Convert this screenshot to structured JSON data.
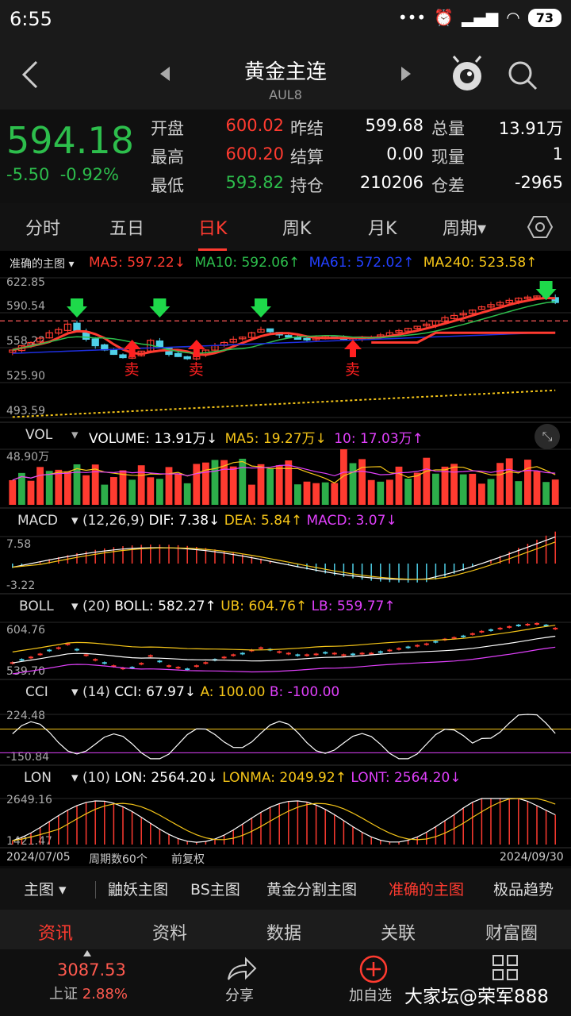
{
  "status": {
    "time": "6:55",
    "battery": "73"
  },
  "header": {
    "title": "黄金主连",
    "code": "AUL8"
  },
  "quote": {
    "price": "594.18",
    "change": "-5.50",
    "change_pct": "-0.92%",
    "rows": [
      {
        "l1": "开盘",
        "v1": "600.02",
        "c1": "#ff3b30",
        "l2": "昨结",
        "v2": "599.68",
        "l3": "总量",
        "v3": "13.91万"
      },
      {
        "l1": "最高",
        "v1": "600.20",
        "c1": "#ff3b30",
        "l2": "结算",
        "v2": "0.00",
        "l3": "现量",
        "v3": "1"
      },
      {
        "l1": "最低",
        "v1": "593.82",
        "c1": "#2dbe4c",
        "l2": "持仓",
        "v2": "210206",
        "l3": "仓差",
        "v3": "-2965"
      }
    ]
  },
  "tabs": [
    "分时",
    "五日",
    "日K",
    "周K",
    "月K",
    "周期▾"
  ],
  "active_tab": "日K",
  "main_chart": {
    "name": "准确的主图",
    "ma5": "MA5: 597.22↓",
    "ma10": "MA10: 592.06↑",
    "ma61": "MA61: 572.02↑",
    "ma240": "MA240: 523.58↑",
    "ticks": [
      "622.85",
      "590.54",
      "558.22",
      "525.90",
      "493.59"
    ],
    "sell": "卖",
    "colors": {
      "ma5": "#ff3b30",
      "ma10": "#2dbe4c",
      "ma61": "#1e2fe0",
      "ma240": "#f5c518"
    }
  },
  "vol": {
    "name": "VOL",
    "v1": "VOLUME: 13.91万↓",
    "v2": "MA5: 19.27万↓",
    "v3": "10: 17.03万↑",
    "tick": "48.90万"
  },
  "macd": {
    "name": "MACD",
    "params": "(12,26,9)",
    "v1": "DIF: 7.38↓",
    "v2": "DEA: 5.84↑",
    "v3": "MACD: 3.07↓",
    "t1": "7.58",
    "t2": "-3.22"
  },
  "boll": {
    "name": "BOLL",
    "params": "(20)",
    "v1": "BOLL: 582.27↑",
    "v2": "UB: 604.76↑",
    "v3": "LB: 559.77↑",
    "t1": "604.76",
    "t2": "539.70"
  },
  "cci": {
    "name": "CCI",
    "params": "(14)",
    "v1": "CCI: 67.97↓",
    "v2": "A: 100.00",
    "v3": "B: -100.00",
    "t1": "224.48",
    "t2": "-150.84"
  },
  "lon": {
    "name": "LON",
    "params": "(10)",
    "v1": "LON: 2564.20↓",
    "v2": "LONMA: 2049.92↑",
    "v3": "LONT: 2564.20↓",
    "t1": "2649.16",
    "t2": "1421.47"
  },
  "axis": {
    "start": "2024/07/05",
    "period": "周期数60个",
    "adj": "前复权",
    "end": "2024/09/30"
  },
  "bottom_tabs": [
    "主图 ▾",
    "鼬妖主图",
    "BS主图",
    "黄金分割主图",
    "准确的主图",
    "极品趋势"
  ],
  "info_tabs": [
    "资讯",
    "资料",
    "数据",
    "关联",
    "财富圈"
  ],
  "footer": {
    "index_value": "3087.53",
    "index_name": "上证",
    "index_pct": "2.88%",
    "share": "分享",
    "add": "加自选",
    "watermark": "大家坛@荣军888"
  }
}
